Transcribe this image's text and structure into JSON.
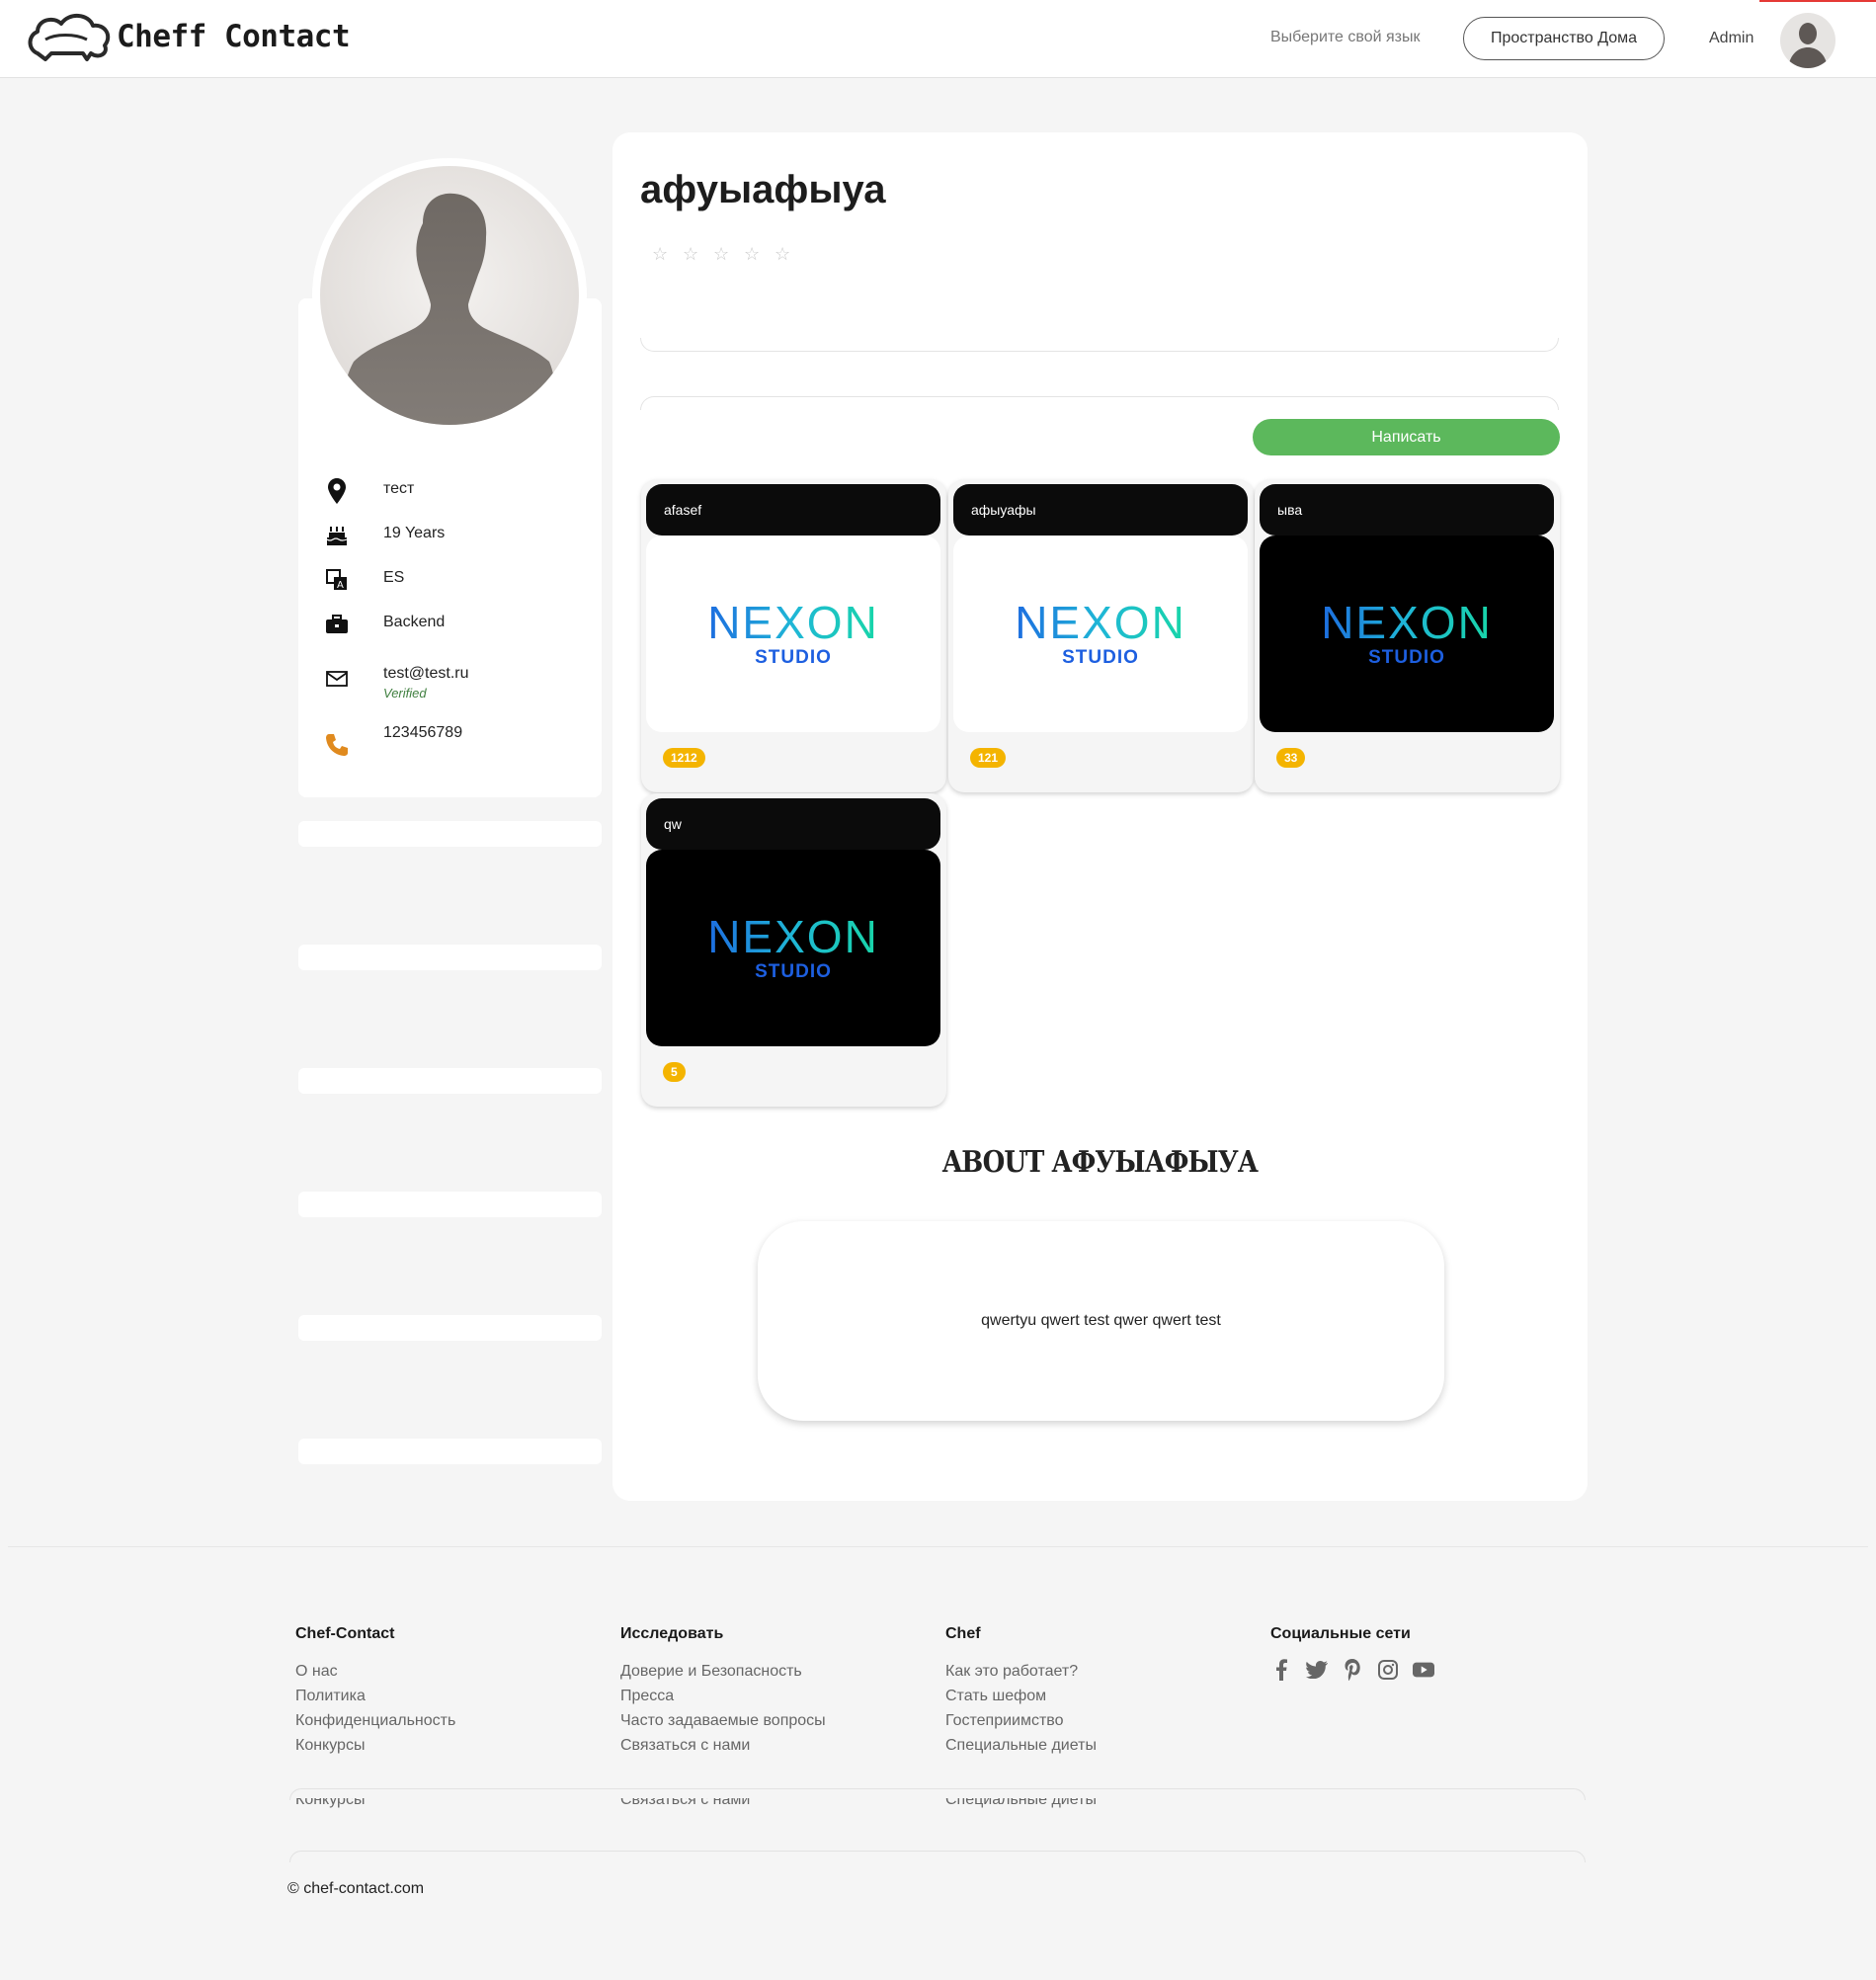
{
  "header": {
    "brand": "Cheff Contact",
    "language_label": "Выберите свой язык",
    "space_button": "Пространство Дома",
    "user_name": "Admin"
  },
  "profile": {
    "name": "афуыафыуа",
    "rating_stars": 5,
    "rating_value": 0,
    "info": [
      {
        "icon": "location-pin-icon",
        "text": "тест"
      },
      {
        "icon": "birthday-cake-icon",
        "text": "19 Years"
      },
      {
        "icon": "language-icon",
        "text": "ES"
      },
      {
        "icon": "briefcase-icon",
        "text": "Backend"
      },
      {
        "icon": "envelope-icon",
        "text": "test@test.ru",
        "note": "Verified"
      },
      {
        "icon": "phone-icon",
        "text": "123456789"
      }
    ],
    "write_button": "Написать"
  },
  "products": [
    {
      "title": "afasef",
      "logo_main": "NEXON",
      "logo_sub": "STUDIO",
      "theme": "light",
      "badge": "1212"
    },
    {
      "title": "афыуафы",
      "logo_main": "NEXON",
      "logo_sub": "STUDIO",
      "theme": "light",
      "badge": "121"
    },
    {
      "title": "ыва",
      "logo_main": "NEXON",
      "logo_sub": "STUDIO",
      "theme": "dark",
      "badge": "33"
    },
    {
      "title": "qw",
      "logo_main": "NEXON",
      "logo_sub": "STUDIO",
      "theme": "dark",
      "badge": "5"
    }
  ],
  "about": {
    "title": "ABOUT АФУЫАФЫУА",
    "text": "qwertyu qwert test qwer qwert test"
  },
  "footer": {
    "columns": [
      {
        "heading": "Chef-Contact",
        "links": [
          "О нас",
          "Политика",
          "Конфиденциальность",
          "Конкурсы"
        ]
      },
      {
        "heading": "Исследовать",
        "links": [
          "Доверие и Безопасность",
          "Пресса",
          "Часто задаваемые вопросы",
          "Связаться с нами"
        ]
      },
      {
        "heading": "Chef",
        "links": [
          "Как это работает?",
          "Стать шефом",
          "Гостеприимство",
          "Специальные диеты"
        ]
      },
      {
        "heading": "Социальные сети",
        "social": [
          "facebook-icon",
          "twitter-icon",
          "pinterest-icon",
          "instagram-icon",
          "youtube-icon"
        ]
      }
    ],
    "copyright": "© chef-contact.com"
  },
  "colors": {
    "accent_green": "#5cb85c",
    "badge_yellow": "#f4b400",
    "verified_green": "#3f7f3f"
  }
}
